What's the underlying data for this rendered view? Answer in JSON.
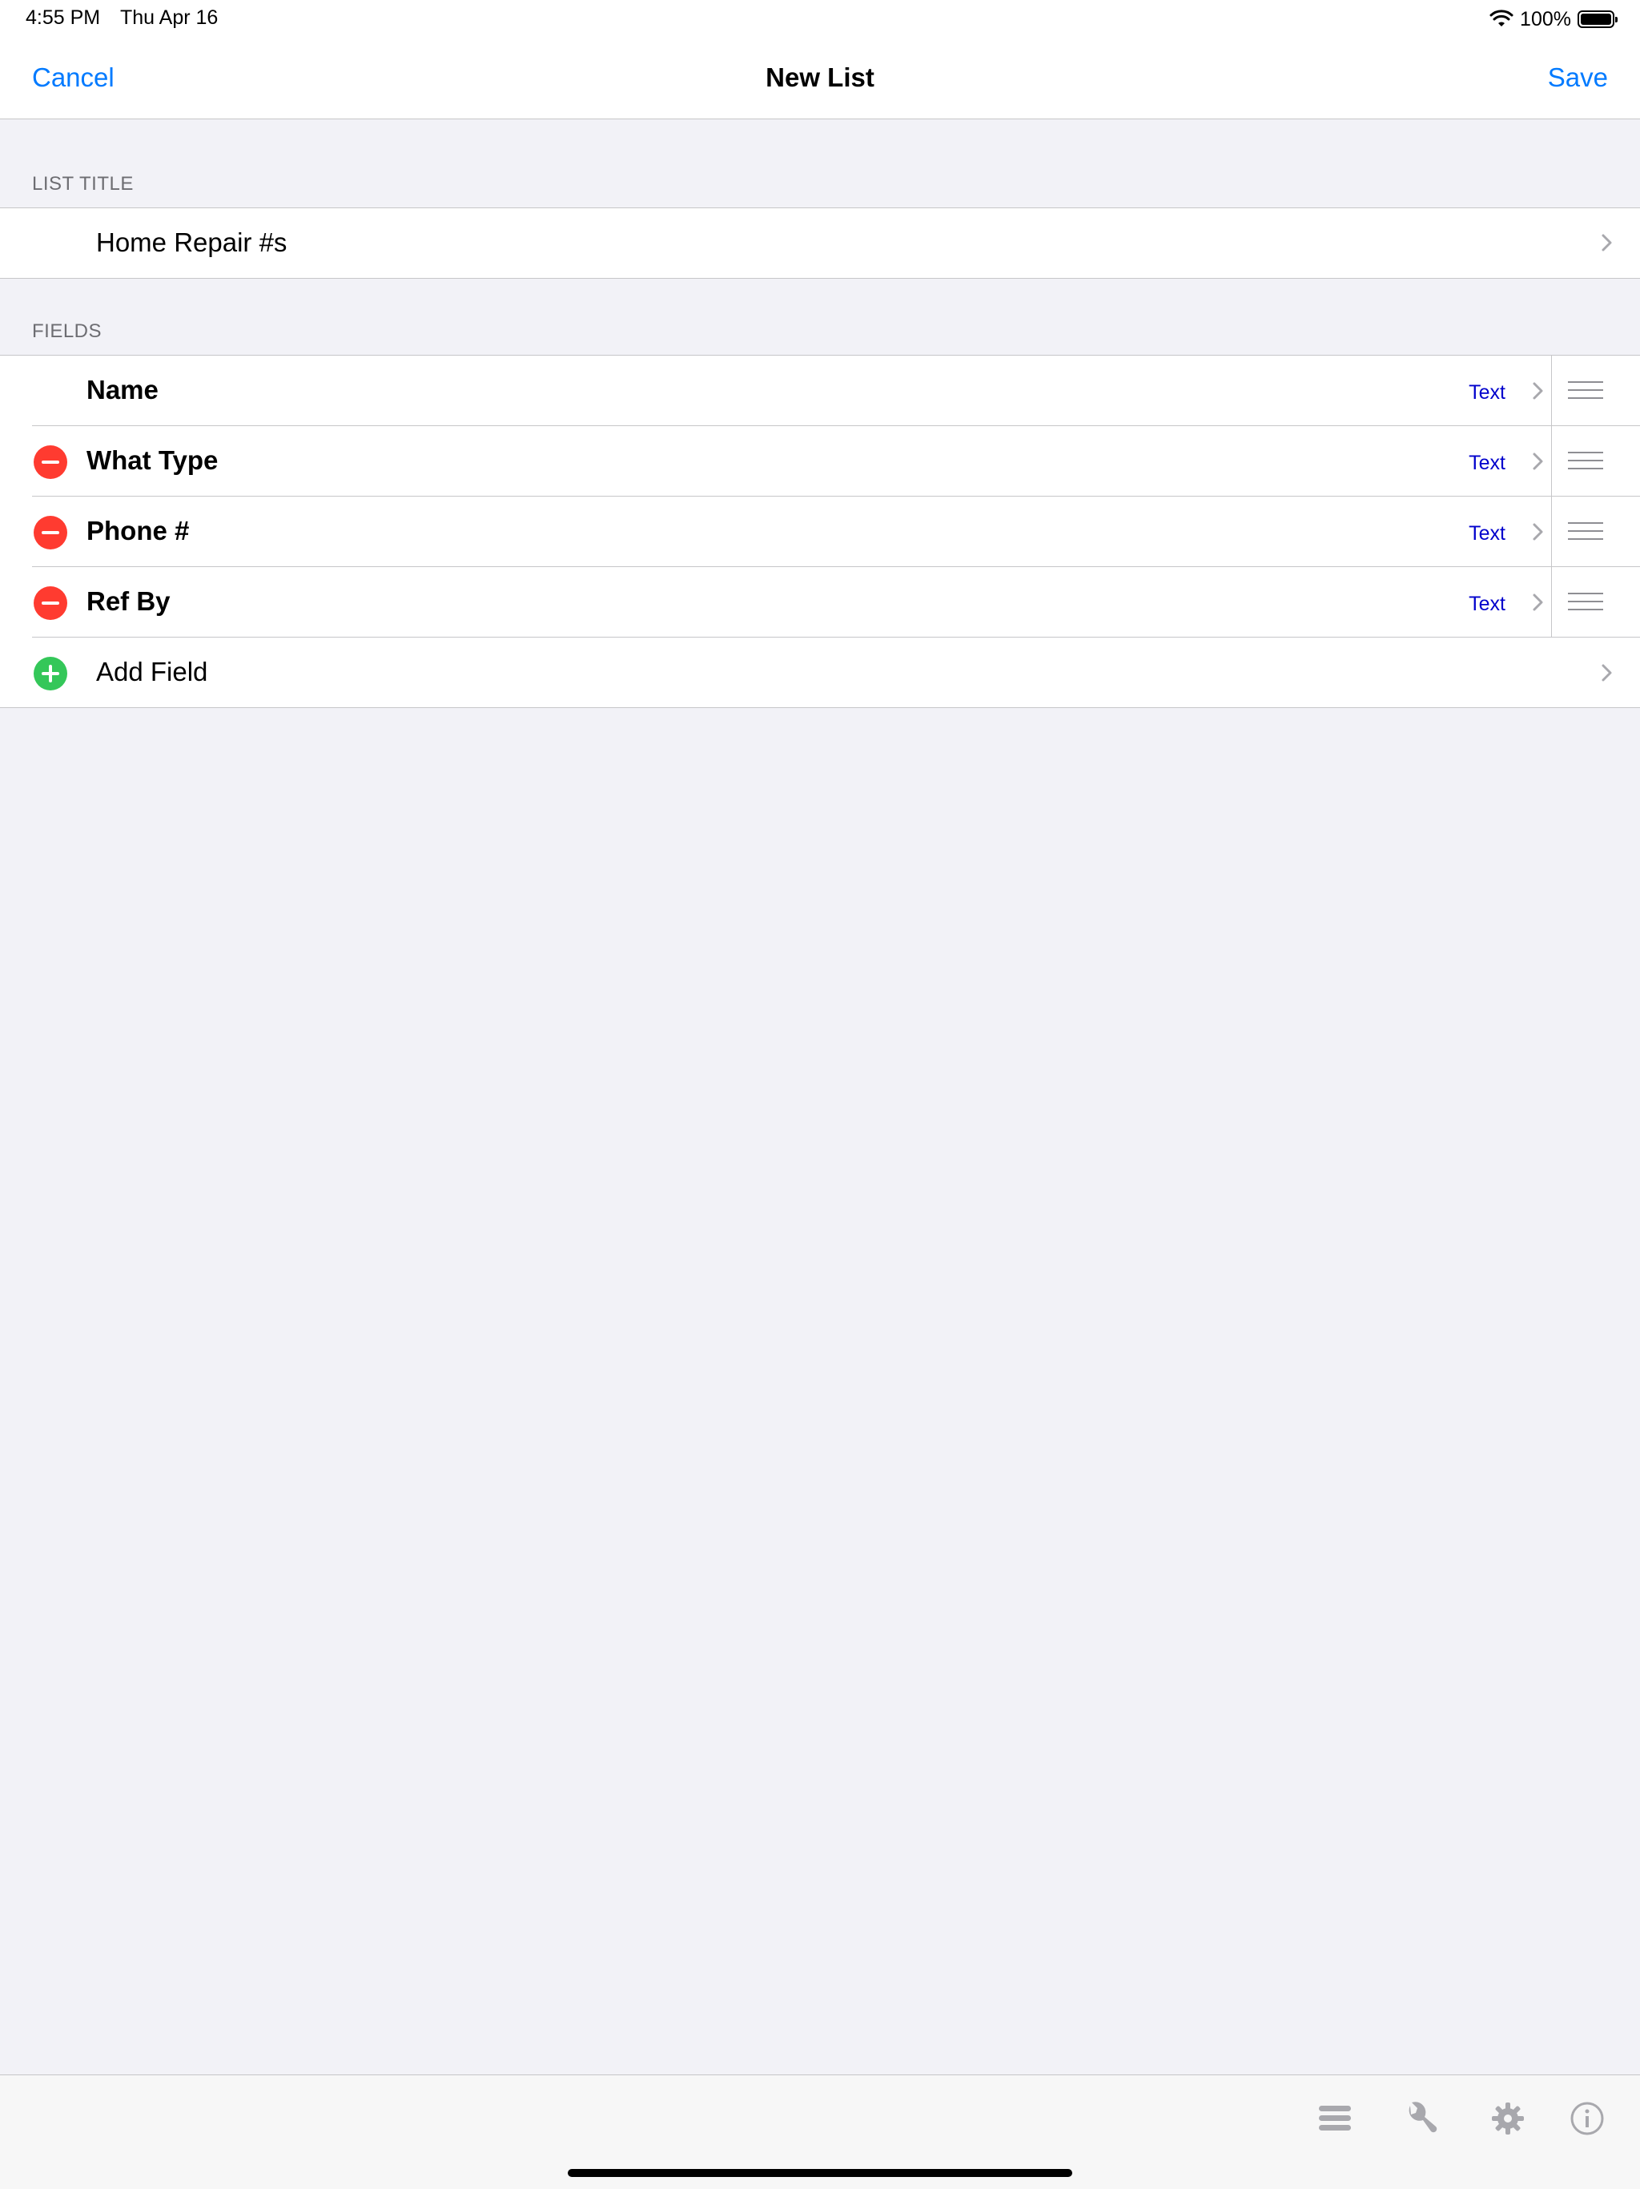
{
  "status_bar": {
    "time": "4:55 PM",
    "date": "Thu Apr 16",
    "battery": "100%",
    "battery_level": 1.0
  },
  "nav": {
    "cancel": "Cancel",
    "title": "New List",
    "save": "Save"
  },
  "list_title": {
    "header": "LIST TITLE",
    "value": "Home Repair #s"
  },
  "fields": {
    "header": "FIELDS",
    "items": [
      {
        "name": "Name",
        "type": "Text",
        "deletable": false
      },
      {
        "name": "What Type",
        "type": "Text",
        "deletable": true
      },
      {
        "name": "Phone #",
        "type": "Text",
        "deletable": true
      },
      {
        "name": "Ref By",
        "type": "Text",
        "deletable": true
      }
    ],
    "add_label": "Add Field"
  },
  "toolbar": {
    "icons": [
      "list-icon",
      "wrench-icon",
      "gear-icon",
      "info-icon"
    ]
  },
  "colors": {
    "accent": "#007aff",
    "delete": "#ff3b30",
    "add": "#34c759",
    "type_text": "#0000cc",
    "background": "#f2f2f7"
  }
}
